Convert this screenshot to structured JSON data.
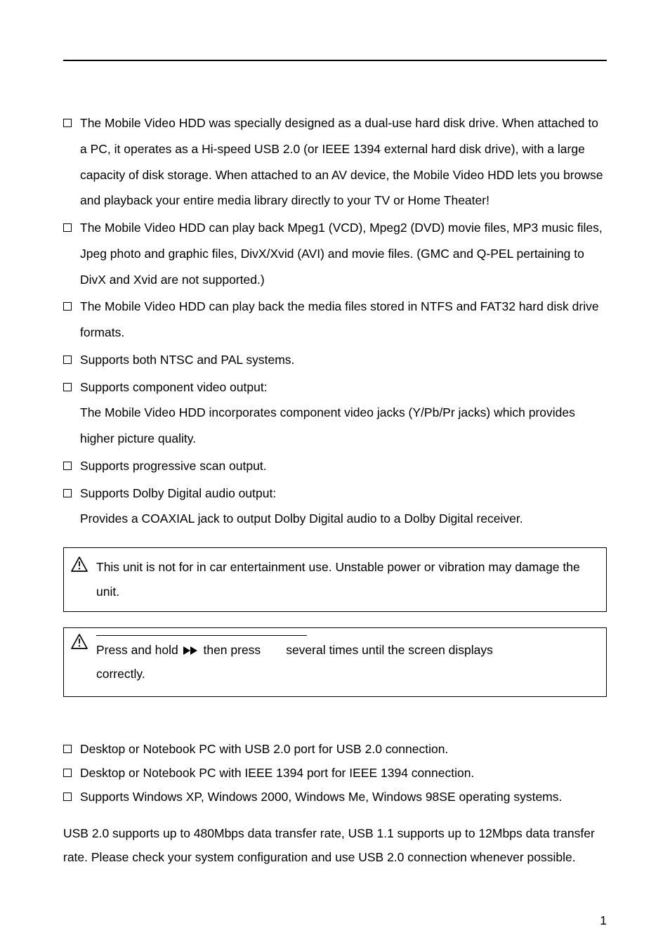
{
  "bullets1": [
    "The Mobile Video HDD was specially designed as a dual-use hard disk drive. When attached to a PC, it operates as a Hi-speed USB 2.0 (or IEEE 1394 external hard disk drive), with a large capacity of disk storage. When attached to an AV device, the Mobile Video HDD lets you browse and playback your entire media library directly to your TV or Home Theater!",
    "The Mobile Video HDD can play back Mpeg1 (VCD), Mpeg2 (DVD) movie files, MP3 music files, Jpeg photo and graphic files, DivX/Xvid (AVI) and movie files. (GMC and Q-PEL pertaining to DivX and Xvid are not supported.)",
    "The Mobile Video HDD can play back the media files stored in NTFS and FAT32 hard disk drive formats.",
    "Supports both NTSC and PAL systems.",
    "Supports component video output:\nThe Mobile Video HDD incorporates component video jacks (Y/Pb/Pr jacks) which provides higher picture quality.",
    "Supports progressive scan output.",
    "Supports Dolby Digital audio output:\nProvides a COAXIAL jack to output Dolby Digital audio to a Dolby Digital receiver."
  ],
  "notice1": "This unit is not for in car entertainment use. Unstable power or vibration may damage the unit.",
  "notice2": {
    "pre": "Press and hold ",
    "mid": " then press",
    "post": "several times until the screen displays correctly."
  },
  "bullets2": [
    "Desktop or Notebook PC with USB 2.0 port for USB 2.0 connection.",
    "Desktop or Notebook PC with IEEE 1394 port for IEEE 1394 connection.",
    "Supports Windows XP, Windows 2000, Windows Me, Windows 98SE operating systems."
  ],
  "post_paragraph": "USB 2.0 supports up to 480Mbps data transfer rate, USB 1.1 supports up to 12Mbps data transfer rate. Please check your system configuration and use USB 2.0 connection whenever possible.",
  "page_number": "1"
}
